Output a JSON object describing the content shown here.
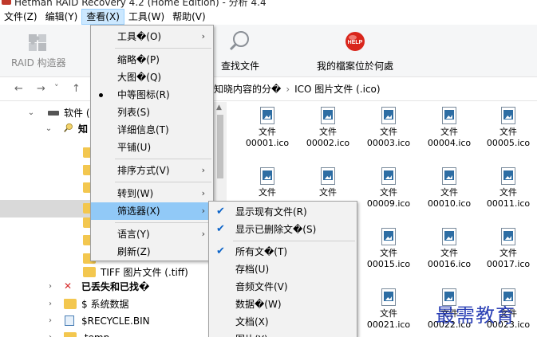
{
  "window": {
    "title": "Hetman RAID Recovery 4.2 (Home Edition) - 分析 4.4"
  },
  "menubar": {
    "items": [
      "文件(Z)",
      "编辑(Y)",
      "查看(X)",
      "工具(W)",
      "帮助(V)"
    ]
  },
  "ribbon": {
    "raid_builder": "RAID 构造器",
    "find_file": "查找文件",
    "where_file": "我的檔案位於何處"
  },
  "nav": {
    "back": "←",
    "forward": "→",
    "dropdown": "˅",
    "up": "↑"
  },
  "breadcrumb": {
    "parent": "知晓内容的分�",
    "sep": "›",
    "current": "ICO 图片文件 (.ico)"
  },
  "tree": {
    "disk": "软件 (",
    "known": "知",
    "tiff": "TIFF 图片文件 (.tiff)",
    "lost": "已丢失和已找�",
    "sysdata": "$ 系统数据",
    "recycle": "$RECYCLE.BIN",
    "temp": ".temp"
  },
  "view_menu": {
    "tools": "工具�(O)",
    "thumbnails": "缩略�(P)",
    "large_icons": "大图�(Q)",
    "medium_icons": "中等图标(R)",
    "list": "列表(S)",
    "details": "详细信息(T)",
    "tiles": "平铺(U)",
    "sort": "排序方式(V)",
    "goto": "转到(W)",
    "filter": "筛选器(X)",
    "language": "语言(Y)",
    "refresh": "刷新(Z)"
  },
  "filter_menu": {
    "show_existing": "显示现有文件(R)",
    "show_deleted": "显示已删除文�(S)",
    "all_files": "所有文�(T)",
    "archives": "存档(U)",
    "audio": "音频文件(V)",
    "data": "数据�(W)",
    "documents": "文档(X)",
    "images": "图片(Y)"
  },
  "files": [
    {
      "t": "文件",
      "n": "00001.ico"
    },
    {
      "t": "文件",
      "n": "00002.ico"
    },
    {
      "t": "文件",
      "n": "00003.ico"
    },
    {
      "t": "文件",
      "n": "00004.ico"
    },
    {
      "t": "文件",
      "n": "00005.ico"
    },
    {
      "t": "文件",
      "n": ""
    },
    {
      "t": "文件",
      "n": ""
    },
    {
      "t": "文件",
      "n": "00009.ico"
    },
    {
      "t": "文件",
      "n": "00010.ico"
    },
    {
      "t": "文件",
      "n": "00011.ico"
    },
    {
      "t": "文件",
      "n": "00015.ico"
    },
    {
      "t": "文件",
      "n": "00016.ico"
    },
    {
      "t": "文件",
      "n": "00017.ico"
    },
    {
      "t": "文件",
      "n": "00021.ico"
    },
    {
      "t": "文件",
      "n": "00022.ico"
    },
    {
      "t": "文件",
      "n": "00023.ico"
    }
  ],
  "watermark": "最需教育",
  "colors": {
    "highlight": "#91c9f7",
    "check": "#0a63c9",
    "folder": "#f3c74f",
    "watermark": "#2a3fb5"
  }
}
